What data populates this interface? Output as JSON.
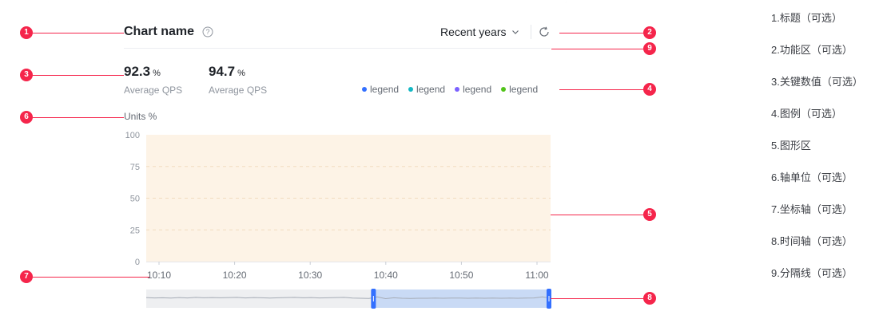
{
  "header": {
    "title": "Chart name",
    "range_label": "Recent years"
  },
  "kpis": [
    {
      "value": "92.3",
      "unit": "%",
      "label": "Average QPS"
    },
    {
      "value": "94.7",
      "unit": "%",
      "label": "Average QPS"
    }
  ],
  "legend": [
    {
      "label": "legend",
      "color": "#3370ff"
    },
    {
      "label": "legend",
      "color": "#14b8c4"
    },
    {
      "label": "legend",
      "color": "#7b61ff"
    },
    {
      "label": "legend",
      "color": "#52c41a"
    }
  ],
  "units_label": "Units %",
  "chart_data": {
    "type": "area",
    "y_ticks": [
      "100",
      "75",
      "50",
      "25",
      "0"
    ],
    "x_ticks": [
      "10:10",
      "10:20",
      "10:30",
      "10:40",
      "10:50",
      "11:00"
    ],
    "ylim": [
      0,
      100
    ],
    "plot_fill": "#fdf3e6"
  },
  "overview_series": [
    56,
    54,
    55,
    53,
    56,
    54,
    57,
    55,
    56,
    55,
    56,
    57,
    54,
    56,
    55,
    53,
    55,
    56,
    57,
    55,
    56,
    54,
    55,
    56,
    57,
    53,
    52,
    51,
    60,
    50,
    55,
    52,
    51,
    52,
    52,
    53,
    52,
    53,
    53,
    52,
    53,
    52,
    53,
    52,
    53,
    52,
    53,
    54,
    60,
    53
  ],
  "overview_selection": [
    0.56,
    1.0
  ],
  "annotation_numbers": [
    "1",
    "2",
    "3",
    "4",
    "5",
    "6",
    "7",
    "8",
    "9"
  ],
  "notes": [
    "1.标题（可选）",
    "2.功能区（可选）",
    "3.关键数值（可选）",
    "4.图例（可选）",
    "5.图形区",
    "6.轴单位（可选）",
    "7.坐标轴（可选）",
    "8.时间轴（可选）",
    "9.分隔线（可选）"
  ],
  "colors": {
    "annotation": "#f5254b",
    "selection_fill": "#c9daf5",
    "handle": "#3370ff"
  }
}
